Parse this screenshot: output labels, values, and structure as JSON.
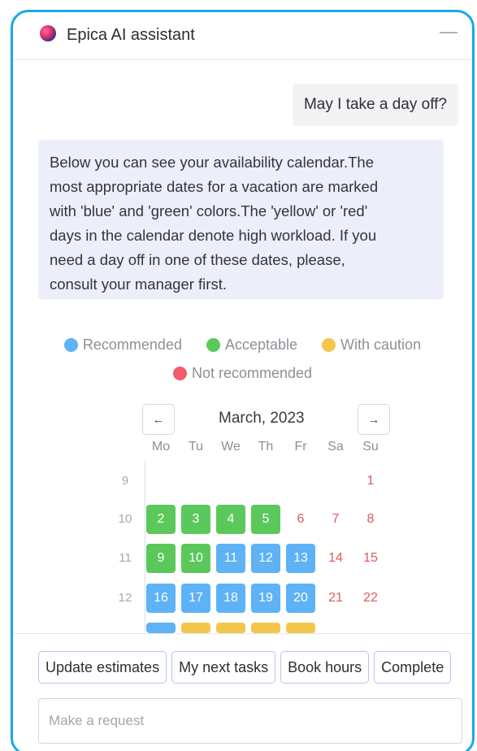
{
  "header": {
    "title": "Epica AI assistant",
    "minimize_label": "—",
    "logo_icon": "epica-logo-icon"
  },
  "chat": {
    "user_message": "May I take a day off?",
    "assistant_lines": [
      "Below you can see your availability calendar.The",
      "most appropriate dates for a vacation are marked",
      "with 'blue' and 'green' colors.The 'yellow' or 'red'",
      "days in the calendar denote high workload. If you",
      "need a day off in one of these dates, please,",
      "consult your manager first."
    ]
  },
  "legend": [
    {
      "label": "Recommended",
      "color": "#5eb2f6"
    },
    {
      "label": "Acceptable",
      "color": "#5bc85b"
    },
    {
      "label": "With caution",
      "color": "#f4c64c"
    },
    {
      "label": "Not recommended",
      "color": "#f25c6e"
    }
  ],
  "calendar": {
    "month": "March, 2023",
    "prev_label": "←",
    "next_label": "→",
    "weekdays": [
      "Mo",
      "Tu",
      "We",
      "Th",
      "Fr",
      "Sa",
      "Su"
    ],
    "weeks": [
      {
        "num": "9",
        "days": [
          null,
          null,
          null,
          null,
          null,
          null,
          {
            "d": "1",
            "s": "red"
          }
        ]
      },
      {
        "num": "10",
        "days": [
          {
            "d": "2",
            "s": "green"
          },
          {
            "d": "3",
            "s": "green"
          },
          {
            "d": "4",
            "s": "green"
          },
          {
            "d": "5",
            "s": "green"
          },
          {
            "d": "6",
            "s": "red"
          },
          {
            "d": "7",
            "s": "red"
          },
          {
            "d": "8",
            "s": "red"
          }
        ]
      },
      {
        "num": "11",
        "days": [
          {
            "d": "9",
            "s": "green"
          },
          {
            "d": "10",
            "s": "green"
          },
          {
            "d": "11",
            "s": "blue"
          },
          {
            "d": "12",
            "s": "blue"
          },
          {
            "d": "13",
            "s": "blue"
          },
          {
            "d": "14",
            "s": "red"
          },
          {
            "d": "15",
            "s": "red"
          }
        ]
      },
      {
        "num": "12",
        "days": [
          {
            "d": "16",
            "s": "blue"
          },
          {
            "d": "17",
            "s": "blue"
          },
          {
            "d": "18",
            "s": "blue"
          },
          {
            "d": "19",
            "s": "blue"
          },
          {
            "d": "20",
            "s": "blue"
          },
          {
            "d": "21",
            "s": "red"
          },
          {
            "d": "22",
            "s": "red"
          }
        ]
      },
      {
        "num": "",
        "days": [
          {
            "d": "",
            "s": "blue"
          },
          {
            "d": "",
            "s": "yellow"
          },
          {
            "d": "",
            "s": "yellow"
          },
          {
            "d": "",
            "s": "yellow"
          },
          {
            "d": "",
            "s": "yellow"
          },
          null,
          null
        ]
      }
    ]
  },
  "quick_actions": [
    "Update estimates",
    "My next tasks",
    "Book hours",
    "Complete"
  ],
  "input": {
    "placeholder": "Make a request",
    "value": ""
  }
}
